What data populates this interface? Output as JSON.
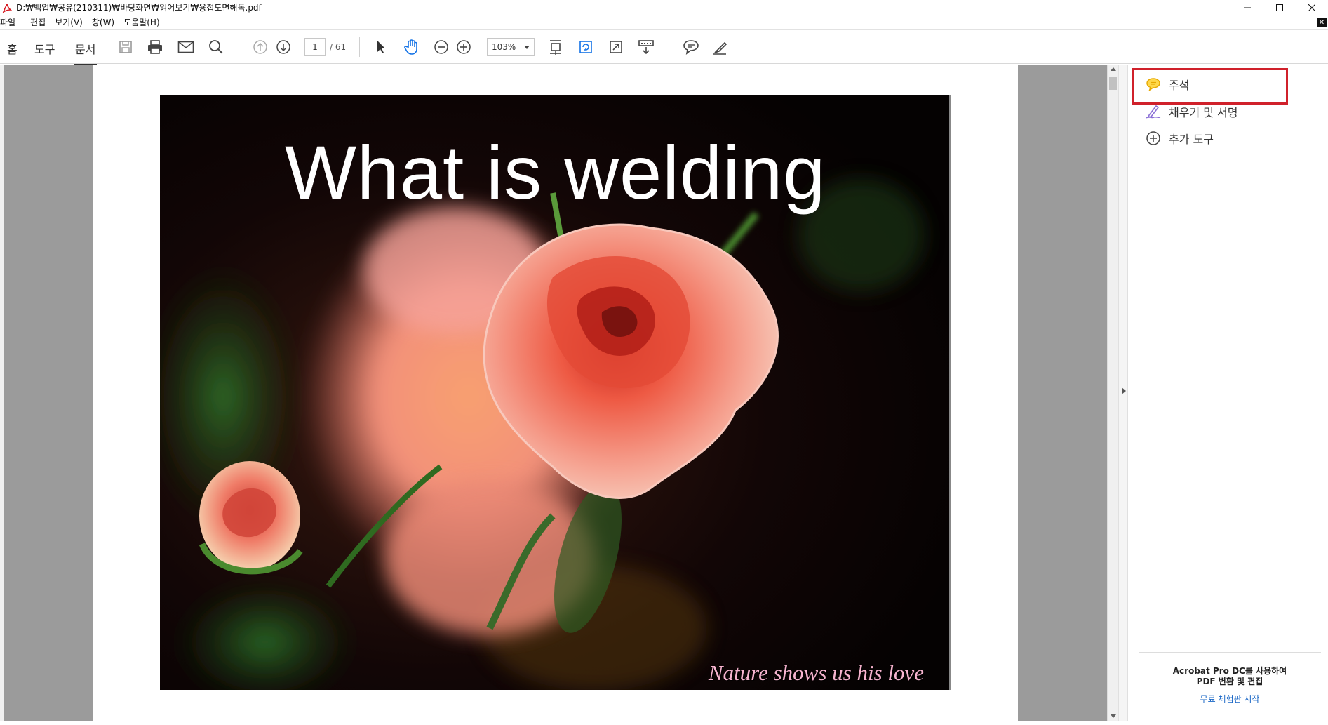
{
  "window": {
    "title": "D:₩백업₩공유(210311)₩바탕화면₩읽어보기₩용접도면해독.pdf"
  },
  "menu": {
    "items": [
      "파일",
      "편집",
      "보기(V)",
      "창(W)",
      "도움말(H)"
    ]
  },
  "toolbar": {
    "tabs": [
      "홈",
      "도구",
      "문서"
    ],
    "active_tab": "문서",
    "page_current": "1",
    "page_total": "/ 61",
    "zoom": "103%"
  },
  "document": {
    "title_text": "What is welding",
    "caption_text": "Nature shows us his love"
  },
  "right_panel": {
    "items": [
      {
        "label": "주석",
        "icon": "comment-icon",
        "color": "#f0b800"
      },
      {
        "label": "채우기 및 서명",
        "icon": "fill-sign-icon",
        "color": "#8a6fd6"
      },
      {
        "label": "추가 도구",
        "icon": "add-circle-icon",
        "color": "#444444"
      }
    ],
    "promo_line1": "Acrobat Pro DC를 사용하여",
    "promo_line2": "PDF 변환 및 편집",
    "promo_link": "무료 체험판 시작"
  },
  "colors": {
    "highlight": "#d0212b",
    "link": "#1a67c6",
    "doc_background": "#9b9b9b"
  }
}
